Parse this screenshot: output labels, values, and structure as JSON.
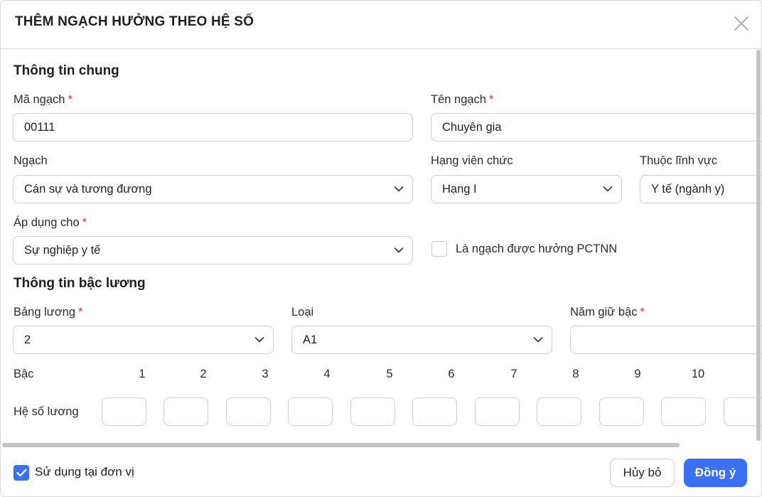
{
  "dialog": {
    "title": "THÊM NGẠCH HƯỞNG THEO HỆ SỐ"
  },
  "general": {
    "section_title": "Thông tin chung",
    "code": {
      "label": "Mã ngạch",
      "required": "*",
      "value": "00111"
    },
    "name": {
      "label": "Tên ngạch",
      "required": "*",
      "value": "Chuyên gia"
    },
    "grade": {
      "label": "Ngạch",
      "value": "Cán sự và tương đương"
    },
    "rank": {
      "label": "Hạng viên chức",
      "value": "Hạng I"
    },
    "field": {
      "label": "Thuộc lĩnh vực",
      "value": "Y tế (ngành y)"
    },
    "apply_for": {
      "label": "Áp dụng cho",
      "required": "*",
      "value": "Sự nghiệp y tế"
    },
    "pctnn": {
      "label": "Là ngạch được hưởng PCTNN",
      "checked": false
    }
  },
  "salary": {
    "section_title": "Thông tin bậc lương",
    "table": {
      "label": "Bảng lương",
      "required": "*",
      "value": "2"
    },
    "type": {
      "label": "Loại",
      "value": "A1"
    },
    "years": {
      "label": "Năm giữ bậc",
      "required": "*",
      "value": ""
    },
    "steps_label": "Bậc",
    "steps": [
      "1",
      "2",
      "3",
      "4",
      "5",
      "6",
      "7",
      "8",
      "9",
      "10"
    ],
    "coef_label": "Hệ số lương"
  },
  "footer": {
    "use_at_unit": {
      "label": "Sử dụng tại đơn vị",
      "checked": true
    },
    "cancel_label": "Hủy bỏ",
    "ok_label": "Đồng ý"
  },
  "colors": {
    "primary": "#3b6ff5",
    "required": "#d9342b",
    "border": "#cfcfcf"
  },
  "icons": {
    "close": "close-icon",
    "dropdown": "chevron-down-icon",
    "check": "check-icon"
  }
}
